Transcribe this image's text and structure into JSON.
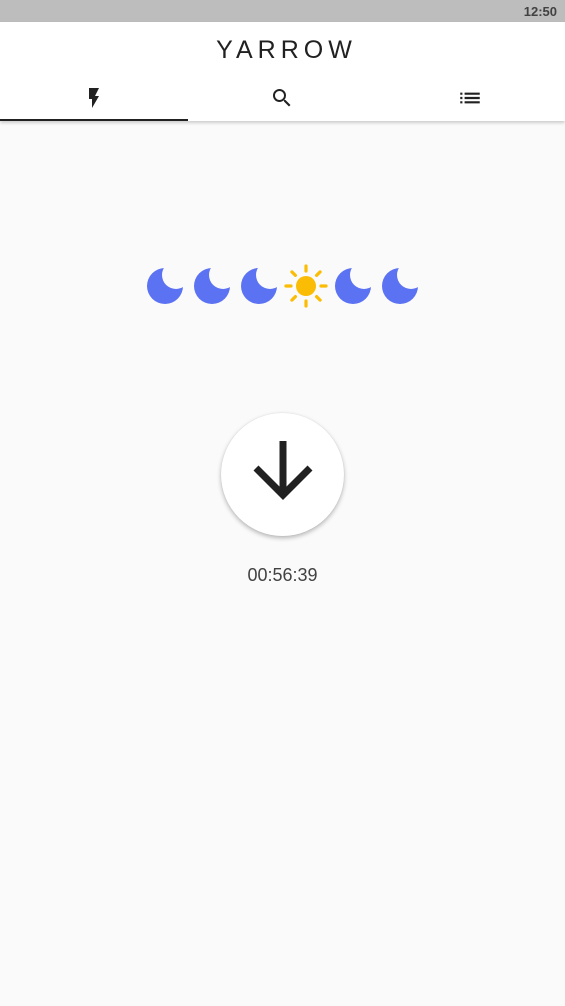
{
  "status_bar": {
    "time": "12:50"
  },
  "app": {
    "title": "YARROW"
  },
  "tabs": [
    {
      "icon": "flash-icon",
      "selected": true
    },
    {
      "icon": "search-icon",
      "selected": false
    },
    {
      "icon": "list-icon",
      "selected": false
    }
  ],
  "phase_sequence": [
    "moon-icon",
    "moon-icon",
    "moon-icon",
    "sun-icon",
    "moon-icon",
    "moon-icon"
  ],
  "colors": {
    "moon": "#5b72f2",
    "sun": "#fbbc05",
    "text": "#212121"
  },
  "action_button": {
    "icon": "arrow-down-icon"
  },
  "timer": {
    "value": "00:56:39"
  }
}
